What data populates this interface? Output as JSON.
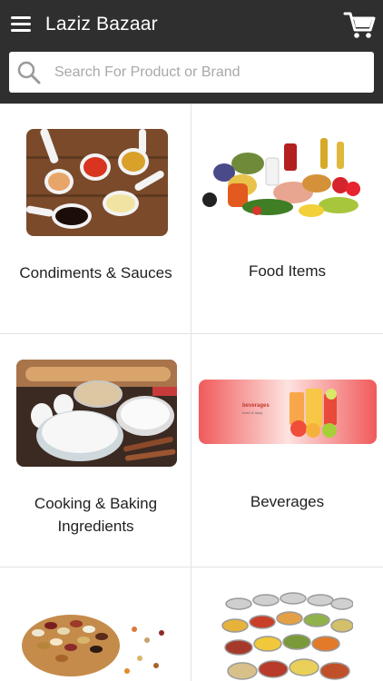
{
  "app": {
    "title": "Laziz Bazaar"
  },
  "header": {
    "menu_icon": "hamburger-menu-icon",
    "cart_icon": "shopping-cart-icon"
  },
  "search": {
    "placeholder": "Search For Product or Brand",
    "value": "",
    "icon": "search-icon"
  },
  "categories": [
    {
      "label": "Condiments & Sauces",
      "image": "condiment-spoons-image"
    },
    {
      "label": "Food Items",
      "image": "food-items-image"
    },
    {
      "label": "Cooking & Baking Ingredients",
      "image": "baking-ingredients-image"
    },
    {
      "label": "Beverages",
      "image": "beverages-banner-image",
      "banner_line1": "beverages",
      "banner_line2": "fresh & tasty"
    },
    {
      "label": "",
      "image": "dried-beans-image"
    },
    {
      "label": "",
      "image": "canned-food-image"
    }
  ],
  "colors": {
    "appbar": "#2f2f2f",
    "background": "#f2f2f2",
    "beverages_banner": "#f05a5a"
  }
}
